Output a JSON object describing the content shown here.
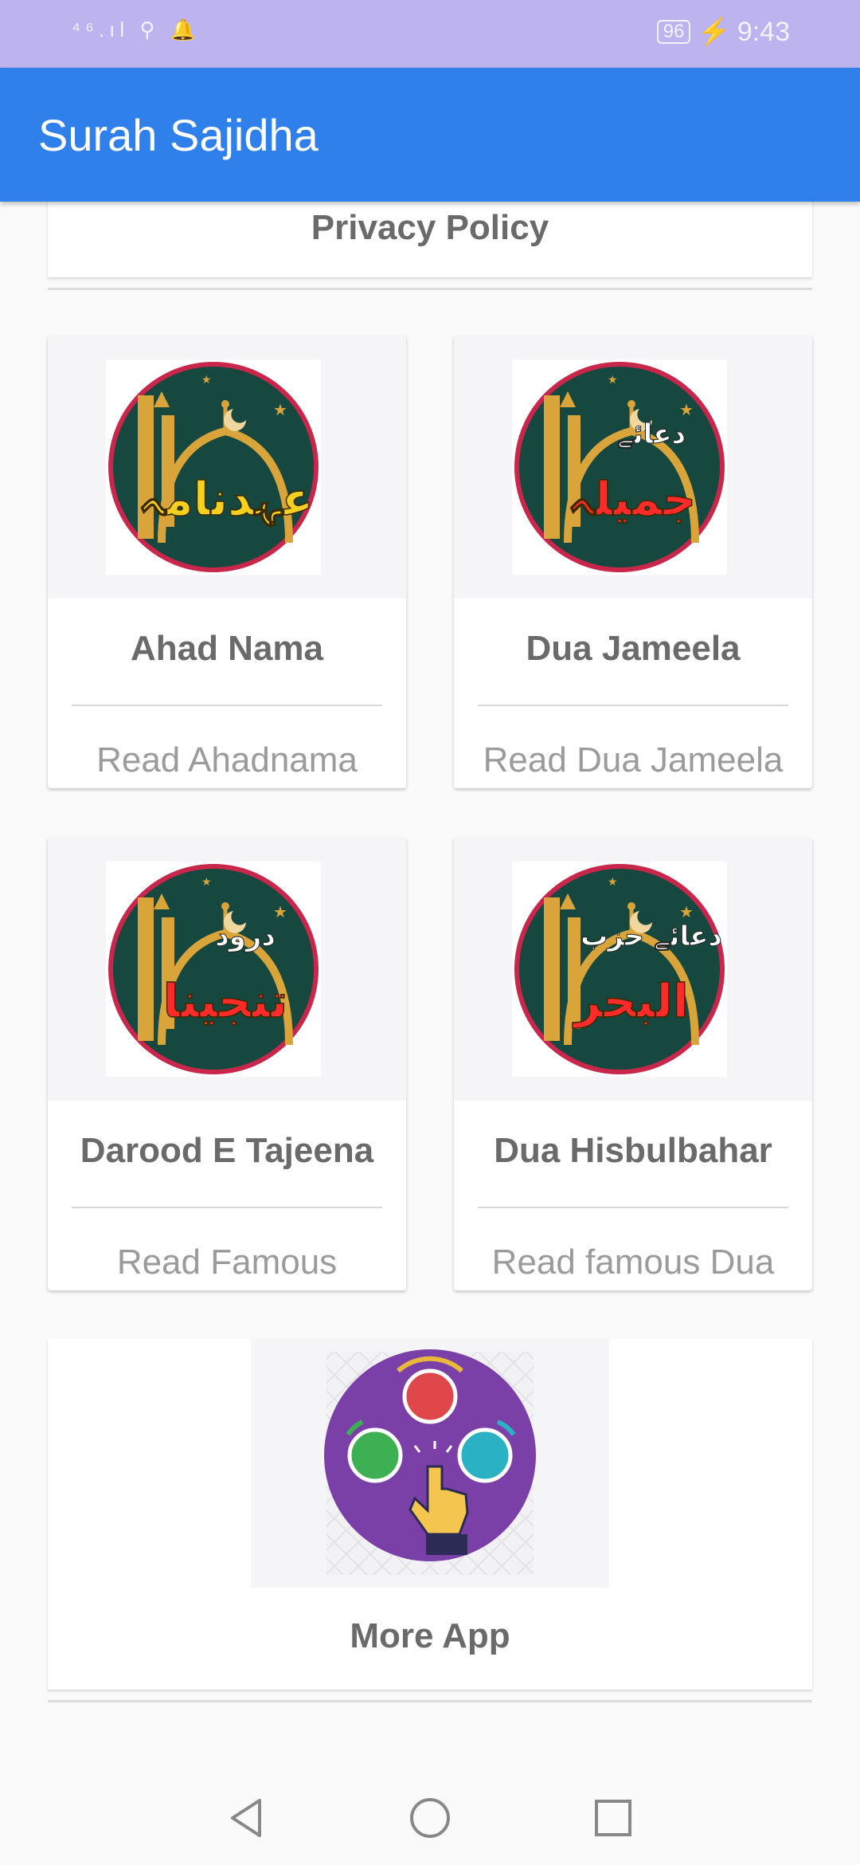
{
  "status_bar": {
    "left_icons": "⁴⁶.ıl ⚲ 🔔",
    "battery": "96",
    "time": "9:43",
    "icons": [
      "signal-icon",
      "usb-icon",
      "notification-bell-icon",
      "battery-icon",
      "charging-icon"
    ]
  },
  "app_bar": {
    "title": "Surah Sajidha"
  },
  "privacy": {
    "label": "Privacy Policy"
  },
  "cards": [
    {
      "title": "Ahad Nama",
      "subtitle": "Read Ahadnama",
      "emblem_text": "عہدنامہ",
      "emblem_color": "#f4d020"
    },
    {
      "title": "Dua Jameela",
      "subtitle": "Read Dua Jameela",
      "emblem_text": "جمیلہ",
      "emblem_top": "دعائے",
      "emblem_color": "#ff2a2a"
    },
    {
      "title": "Darood E Tajeena",
      "subtitle": "Read Famous",
      "emblem_text": "تنجینا",
      "emblem_top": "درود",
      "emblem_color": "#ff2a2a"
    },
    {
      "title": "Dua Hisbulbahar",
      "subtitle": "Read famous Dua",
      "emblem_text": "البحر",
      "emblem_top": "دعائے حزب",
      "emblem_color": "#ff2a2a"
    }
  ],
  "more": {
    "title": "More App"
  },
  "colors": {
    "app_bar": "#3080eb",
    "status_bar": "#bdb4ef",
    "emblem_green": "#17483f",
    "emblem_ring": "#c8264a",
    "more_purple": "#7b3fa8"
  },
  "nav": [
    "back-icon",
    "home-icon",
    "recents-icon"
  ]
}
